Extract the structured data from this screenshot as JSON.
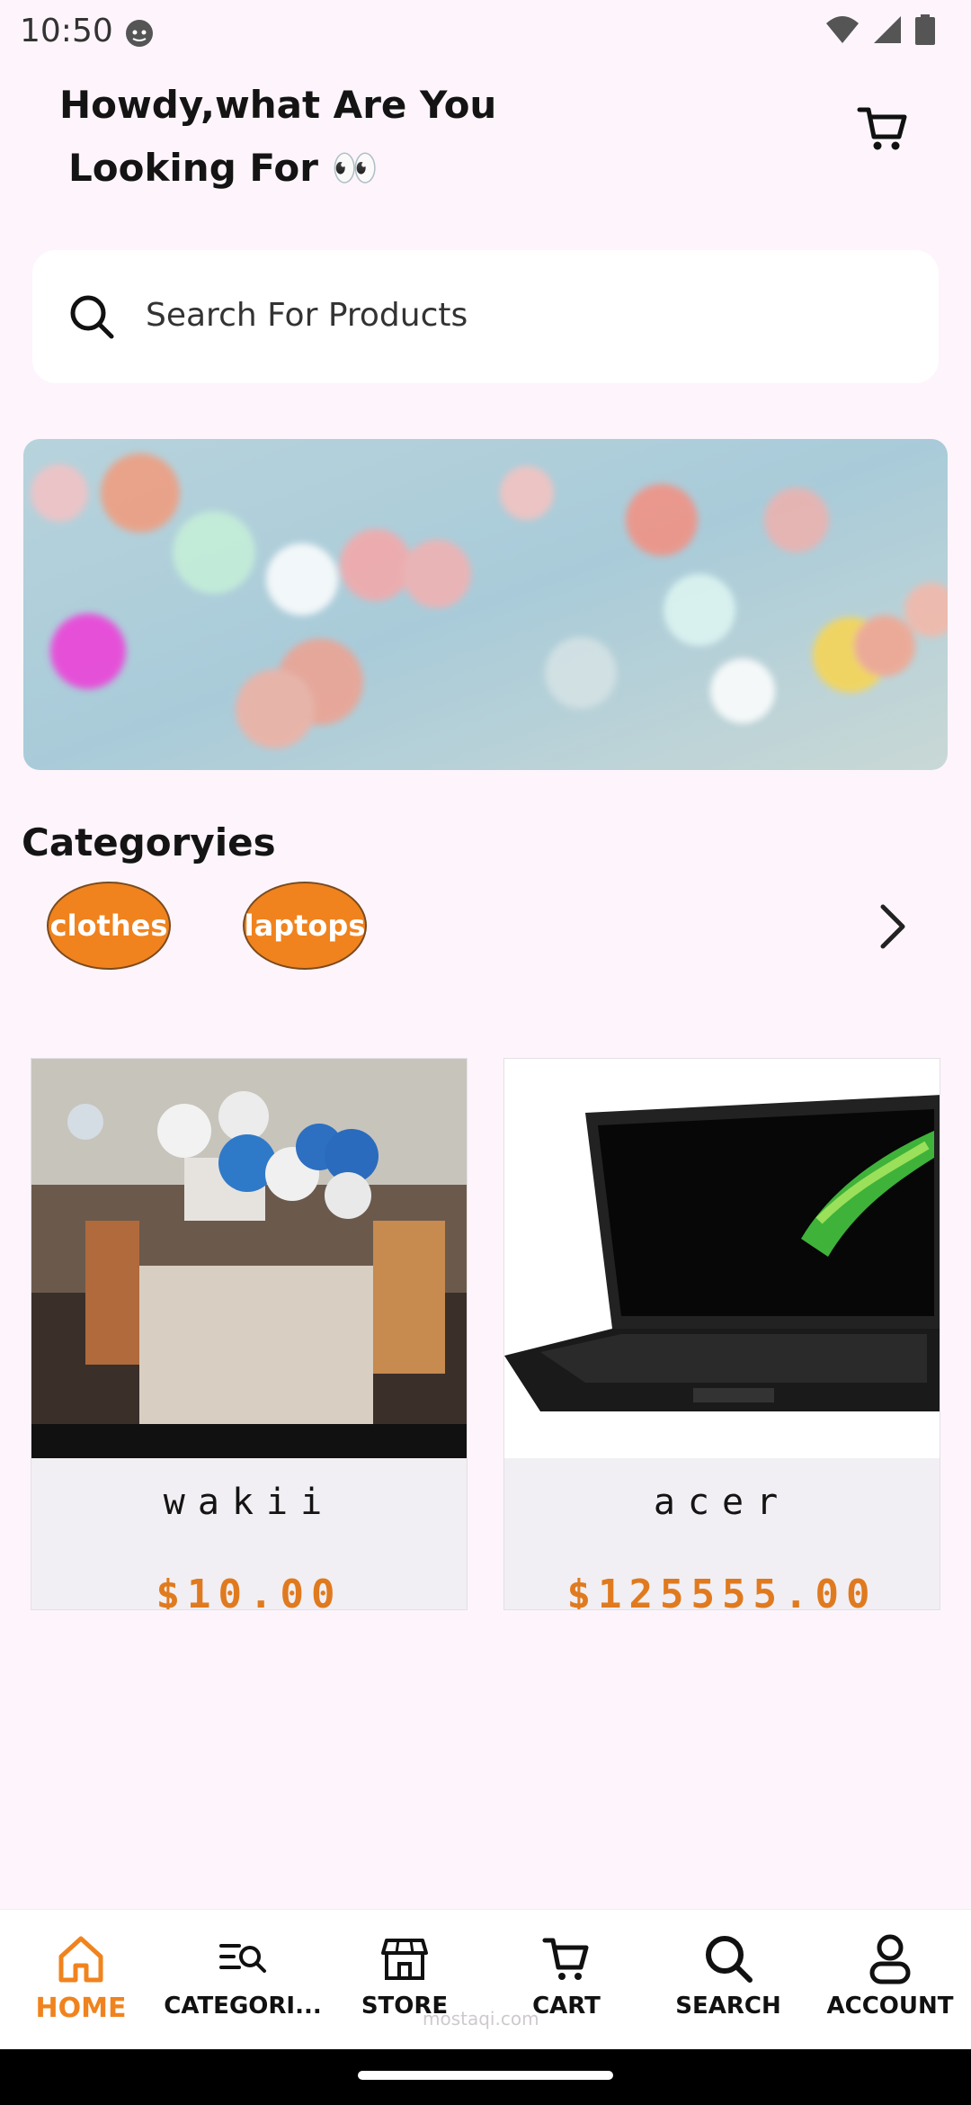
{
  "status_bar": {
    "time": "10:50",
    "icons": [
      "face-icon",
      "wifi-icon",
      "cellular-signal-icon",
      "battery-icon"
    ]
  },
  "header": {
    "greeting_line1": "Howdy,what Are You",
    "greeting_line2": "Looking For 👀",
    "cart_icon": "cart-icon"
  },
  "search": {
    "placeholder": "Search For Products",
    "icon": "search-icon"
  },
  "banner": {
    "image": "bokeh-lights-banner"
  },
  "categories": {
    "title": "Categoryies",
    "items": [
      {
        "label": "clothes"
      },
      {
        "label": "laptops"
      }
    ],
    "more_icon": "chevron-right-icon"
  },
  "products": [
    {
      "name": "wakii",
      "price": "$10.00",
      "image": "clothing-store-photo"
    },
    {
      "name": "acer",
      "price": "$125555.00",
      "image": "acer-laptop-photo"
    }
  ],
  "bottom_nav": {
    "items": [
      {
        "label": "HOME",
        "icon": "home-icon",
        "active": true
      },
      {
        "label": "CATEGORI...",
        "icon": "categories-icon",
        "active": false
      },
      {
        "label": "STORE",
        "icon": "store-icon",
        "active": false
      },
      {
        "label": "CART",
        "icon": "cart-icon",
        "active": false
      },
      {
        "label": "SEARCH",
        "icon": "search-icon",
        "active": false
      },
      {
        "label": "ACCOUNT",
        "icon": "account-icon",
        "active": false
      }
    ]
  },
  "watermark": "mostaqi.com",
  "colors": {
    "accent": "#f0831e",
    "background": "#fdf5fb",
    "price": "#e07a1f"
  }
}
